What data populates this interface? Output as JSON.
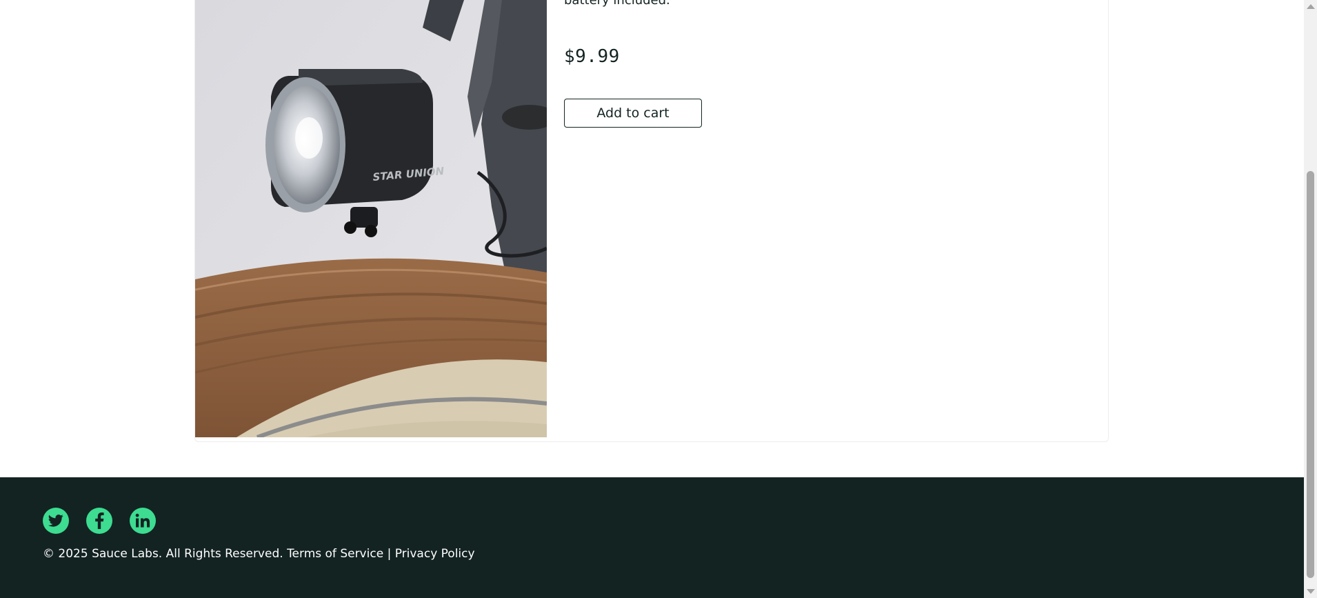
{
  "product": {
    "description_tail": "battery included.",
    "price": "$9.99",
    "add_to_cart_label": "Add to cart",
    "image_brand_text": "STAR UNION"
  },
  "footer": {
    "social": [
      {
        "name": "twitter",
        "icon": "twitter-icon"
      },
      {
        "name": "facebook",
        "icon": "facebook-icon"
      },
      {
        "name": "linkedin",
        "icon": "linkedin-icon"
      }
    ],
    "copyright": "© 2025 Sauce Labs. All Rights Reserved.",
    "terms_label": "Terms of Service",
    "separator": "|",
    "privacy_label": "Privacy Policy"
  },
  "colors": {
    "footer_bg": "#132322",
    "accent": "#3ddc91",
    "text": "#132322"
  }
}
